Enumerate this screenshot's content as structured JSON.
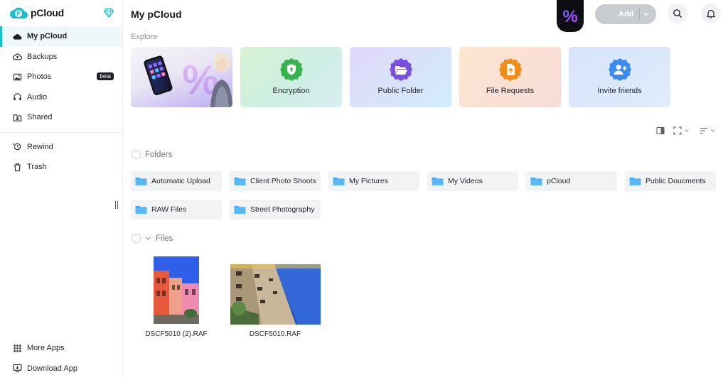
{
  "app": {
    "logo_text": "pCloud"
  },
  "sidebar": {
    "items": [
      {
        "label": "My pCloud",
        "icon": "cloud-icon",
        "active": true
      },
      {
        "label": "Backups",
        "icon": "cloud-upload-icon"
      },
      {
        "label": "Photos",
        "icon": "image-icon",
        "badge": "beta"
      },
      {
        "label": "Audio",
        "icon": "headphones-icon"
      },
      {
        "label": "Shared",
        "icon": "shared-folder-icon"
      }
    ],
    "secondary": [
      {
        "label": "Rewind",
        "icon": "rewind-icon"
      },
      {
        "label": "Trash",
        "icon": "trash-icon"
      }
    ],
    "bottom": [
      {
        "label": "More Apps",
        "icon": "apps-grid-icon"
      },
      {
        "label": "Download App",
        "icon": "monitor-download-icon"
      }
    ]
  },
  "header": {
    "title": "My pCloud",
    "promo_symbol": "%",
    "add_label": "Add"
  },
  "explore": {
    "label": "Explore",
    "cards": [
      {
        "label": "Encryption",
        "icon": "shield-lock-icon",
        "color": "#37b24d"
      },
      {
        "label": "Public Folder",
        "icon": "open-folder-icon",
        "color": "#7a4fe0"
      },
      {
        "label": "File Requests",
        "icon": "file-upload-icon",
        "color": "#f08c1a"
      },
      {
        "label": "Invite friends",
        "icon": "add-user-icon",
        "color": "#3b8cf0"
      }
    ]
  },
  "folders": {
    "label": "Folders",
    "items": [
      "Automatic Upload",
      "Client Photo Shoots",
      "My Pictures",
      "My Videos",
      "pCloud",
      "Public Doucments",
      "RAW Files",
      "Street Photography"
    ]
  },
  "files": {
    "label": "Files",
    "items": [
      {
        "name": "DSCF5010 (2).RAF"
      },
      {
        "name": "DSCF5010.RAF"
      }
    ]
  },
  "colors": {
    "accent": "#17bed0",
    "folder": "#3fa9f5"
  }
}
